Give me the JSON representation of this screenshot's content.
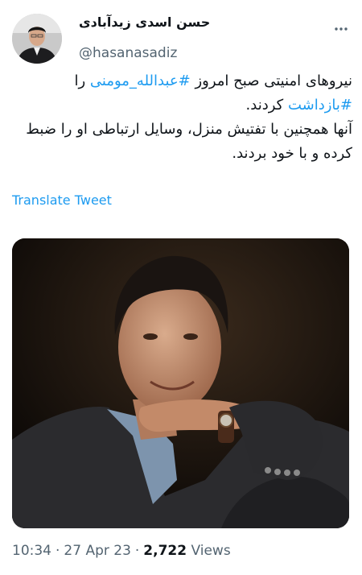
{
  "author": {
    "display_name": "حسن اسدی زیدآبادی",
    "handle": "@hasanasadiz"
  },
  "icons": {
    "more": "more-horizontal-icon",
    "avatar": "user-avatar-photo"
  },
  "tweet": {
    "line1_prefix": "نیروهای امنیتی صبح امروز ",
    "hashtag1": "#عبدالله_مومنی",
    "line1_suffix": " را",
    "hashtag2": "#بازداشت",
    "line2_suffix": " کردند.",
    "paragraph2": "آنها همچنین با تفتیش منزل، وسایل ارتباطی او را ضبط کرده و با خود بردند."
  },
  "translate_label": "Translate Tweet",
  "meta": {
    "time": "10:34",
    "date": "27 Apr 23",
    "views_count": "2,722",
    "views_label": "Views"
  },
  "colors": {
    "link": "#1d9bf0",
    "text": "#0f1419",
    "secondary": "#536471",
    "background": "#ffffff"
  }
}
